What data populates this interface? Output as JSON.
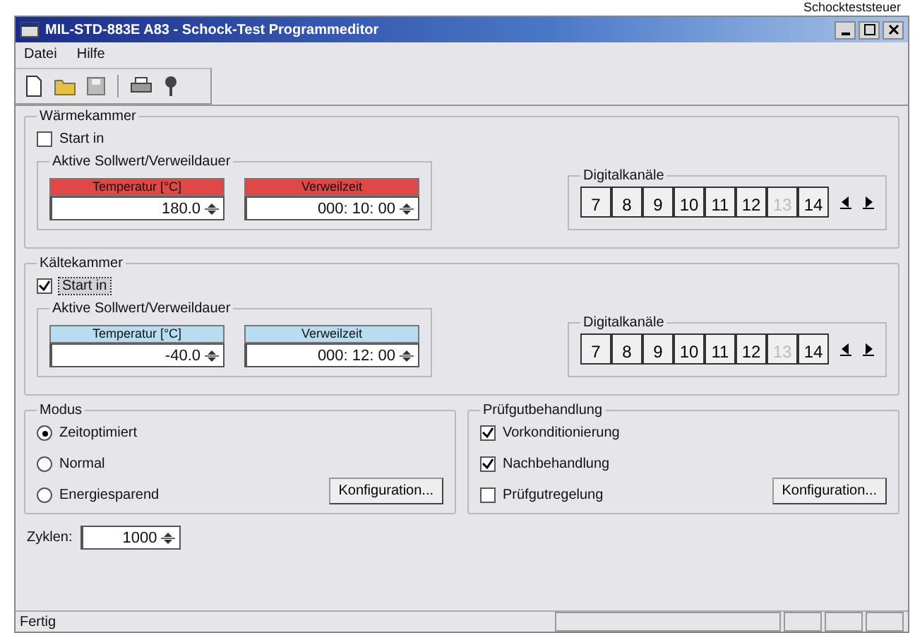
{
  "caption": "Schockteststeuer",
  "window": {
    "title": "MIL-STD-883E A83 - Schock-Test Programmeditor"
  },
  "menu": [
    "Datei",
    "Hilfe"
  ],
  "chambers": [
    {
      "title": "Wärmekammer",
      "start": {
        "label": "Start in",
        "checked": false
      },
      "group": "Aktive Sollwert/Verweildauer",
      "color": "#e04848",
      "fields": [
        {
          "header": "Temperatur [°C]",
          "value": "180.0"
        },
        {
          "header": "Verweilzeit",
          "value": "000: 10: 00"
        }
      ],
      "channels_title": "Digitalkanäle",
      "channels": [
        {
          "label": "7",
          "disabled": false
        },
        {
          "label": "8",
          "disabled": false
        },
        {
          "label": "9",
          "disabled": false
        },
        {
          "label": "10",
          "disabled": false
        },
        {
          "label": "11",
          "disabled": false
        },
        {
          "label": "12",
          "disabled": false
        },
        {
          "label": "13",
          "disabled": true
        },
        {
          "label": "14",
          "disabled": false
        }
      ]
    },
    {
      "title": "Kältekammer",
      "start": {
        "label": "Start in",
        "checked": true
      },
      "group": "Aktive Sollwert/Verweildauer",
      "color": "#b8dcf0",
      "fields": [
        {
          "header": "Temperatur [°C]",
          "value": "-40.0"
        },
        {
          "header": "Verweilzeit",
          "value": "000: 12: 00"
        }
      ],
      "channels_title": "Digitalkanäle",
      "channels": [
        {
          "label": "7",
          "disabled": false
        },
        {
          "label": "8",
          "disabled": false
        },
        {
          "label": "9",
          "disabled": false
        },
        {
          "label": "10",
          "disabled": false
        },
        {
          "label": "11",
          "disabled": false
        },
        {
          "label": "12",
          "disabled": false
        },
        {
          "label": "13",
          "disabled": true
        },
        {
          "label": "14",
          "disabled": false
        }
      ]
    }
  ],
  "modus": {
    "title": "Modus",
    "options": [
      {
        "label": "Zeitoptimiert",
        "selected": true
      },
      {
        "label": "Normal",
        "selected": false
      },
      {
        "label": "Energiesparend",
        "selected": false
      }
    ],
    "button": "Konfiguration..."
  },
  "pruefgut": {
    "title": "Prüfgutbehandlung",
    "options": [
      {
        "label": "Vorkonditionierung",
        "checked": true
      },
      {
        "label": "Nachbehandlung",
        "checked": true
      },
      {
        "label": "Prüfgutregelung",
        "checked": false
      }
    ],
    "button": "Konfiguration..."
  },
  "cycles": {
    "label": "Zyklen:",
    "value": "1000"
  },
  "status_bar": "Fertig"
}
